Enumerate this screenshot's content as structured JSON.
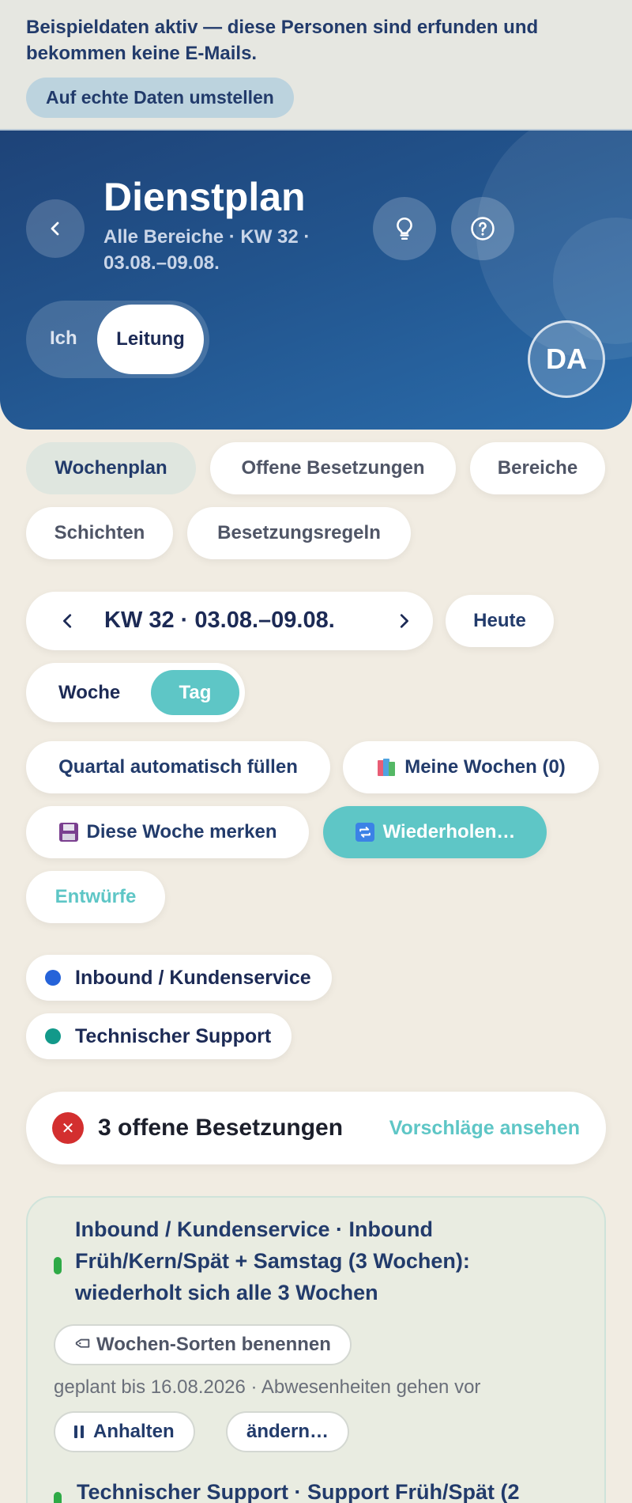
{
  "demo_banner": {
    "message": "Beispieldaten aktiv — diese Personen sind erfunden und bekommen keine E-Mails.",
    "switch_button": "Auf echte Daten umstellen"
  },
  "header": {
    "title": "Dienstplan",
    "subtitle": "Alle Bereiche · KW 32 · 03.08.–09.08.",
    "avatar_initials": "DA",
    "role_options": [
      "Ich",
      "Leitung"
    ],
    "role_selected": "Leitung"
  },
  "tabs": [
    "Wochenplan",
    "Offene Besetzungen",
    "Bereiche",
    "Schichten",
    "Besetzungsregeln"
  ],
  "tab_active": "Wochenplan",
  "week_nav": {
    "label": "KW 32 · 03.08.–09.08.",
    "today_button": "Heute"
  },
  "view_toggle": {
    "options": [
      "Woche",
      "Tag"
    ],
    "selected": "Tag"
  },
  "actions": {
    "fill_quarter": "Quartal automatisch füllen",
    "my_weeks": "Meine Wochen (0)",
    "remember_week": "Diese Woche merken",
    "repeat": "Wiederholen…",
    "drafts": "Entwürfe"
  },
  "areas": [
    {
      "label": "Inbound / Kundenservice",
      "color": "#2563d9"
    },
    {
      "label": "Technischer Support",
      "color": "#12998a"
    }
  ],
  "open_positions": {
    "text": "3 offene Besetzungen",
    "link": "Vorschläge ansehen"
  },
  "recurrences": [
    {
      "title": "Inbound / Kundenservice · Inbound Früh/Kern/Spät + Samstag (3 Wochen): wiederholt sich alle 3 Wochen",
      "title_lines": [
        "Inbound / Kundenservice · Inbound",
        "Früh/Kern/Spät + Samstag (3 Wochen):",
        "wiederholt sich alle 3 Wochen"
      ],
      "name_weeks_button": "Wochen-Sorten benennen",
      "meta": "geplant bis 16.08.2026 · Abwesenheiten gehen vor",
      "pause_button": "Anhalten",
      "edit_button": "ändern…"
    },
    {
      "title_first_line": "Technischer Support · Support Früh/Spät (2"
    }
  ],
  "colors": {
    "accent_teal": "#5ec6c6",
    "navy": "#1c2a55",
    "header_blue": "#22548d",
    "error_red": "#d32f2f",
    "recurrence_green": "#2eaa46"
  }
}
